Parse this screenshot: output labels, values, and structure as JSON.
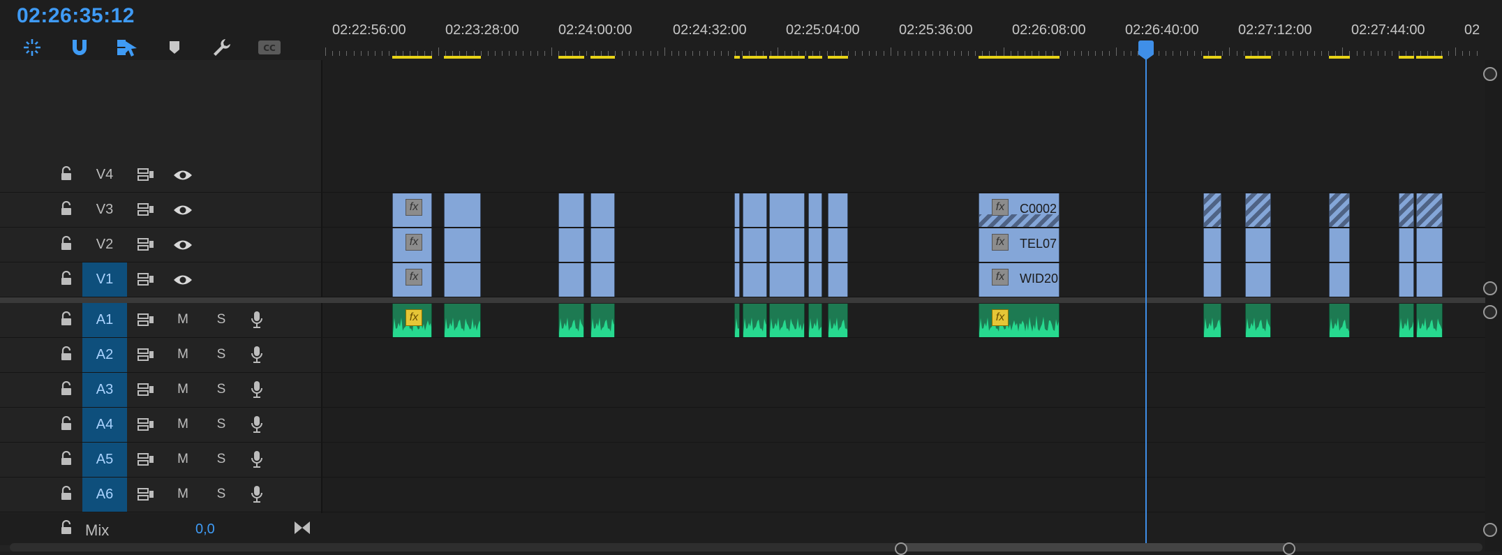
{
  "timecode": "02:26:35:12",
  "ruler": {
    "labels": [
      "02:22:56:00",
      "02:23:28:00",
      "02:24:00:00",
      "02:24:32:00",
      "02:25:04:00",
      "02:25:36:00",
      "02:26:08:00",
      "02:26:40:00",
      "02:27:12:00",
      "02:27:44:00",
      "02"
    ]
  },
  "tracks": {
    "video": [
      {
        "label": "V4"
      },
      {
        "label": "V3"
      },
      {
        "label": "V2"
      },
      {
        "label": "V1"
      }
    ],
    "audio": [
      {
        "label": "A1",
        "mute": "M",
        "solo": "S"
      },
      {
        "label": "A2",
        "mute": "M",
        "solo": "S"
      },
      {
        "label": "A3",
        "mute": "M",
        "solo": "S"
      },
      {
        "label": "A4",
        "mute": "M",
        "solo": "S"
      },
      {
        "label": "A5",
        "mute": "M",
        "solo": "S"
      },
      {
        "label": "A6",
        "mute": "M",
        "solo": "S"
      }
    ]
  },
  "clips": {
    "fx_label": "fx",
    "v3_name": "C0002",
    "v2_name": "TEL07",
    "v1_name": "WID20"
  },
  "mix": {
    "label": "Mix",
    "value": "0,0"
  },
  "colors": {
    "accent": "#3f9bf5",
    "video_clip": "#84a6d8",
    "audio_clip": "#1d7a52",
    "work_area": "#e8d317",
    "target_track": "#0e4f7c"
  },
  "icons": {
    "toolbar": [
      "snap-nest-icon",
      "magnet-icon",
      "linked-selection-icon",
      "marker-icon",
      "wrench-icon",
      "captions-icon"
    ]
  }
}
